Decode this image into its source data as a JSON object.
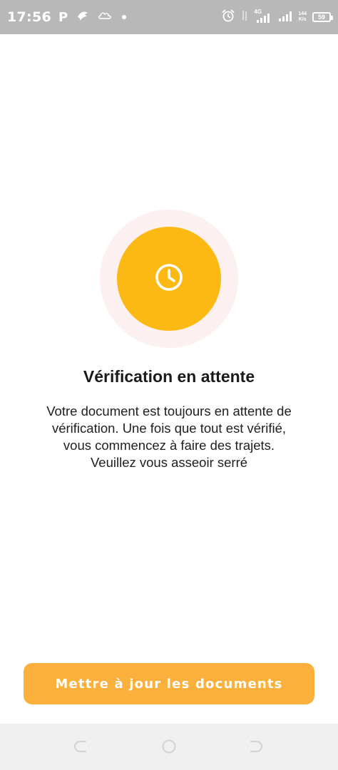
{
  "status_bar": {
    "time": "17:56",
    "p_label": "P",
    "network_type": "4G",
    "net_speed_value": "144",
    "net_speed_unit": "K/s",
    "battery_level": "59"
  },
  "verification": {
    "title": "Vérification en attente",
    "message_lines": [
      "Votre document est toujours en attente de",
      "vérification. Une fois que tout est vérifié,",
      "vous commencez à faire des trajets.",
      "Veuillez vous asseoir serré"
    ],
    "icon": "clock-icon"
  },
  "actions": {
    "update_documents_label": "Mettre à jour les documents"
  },
  "colors": {
    "accent": "#fdb913",
    "button": "#fbb03b",
    "halo": "#fdf0f0",
    "status_bar": "#b8b8b8"
  }
}
